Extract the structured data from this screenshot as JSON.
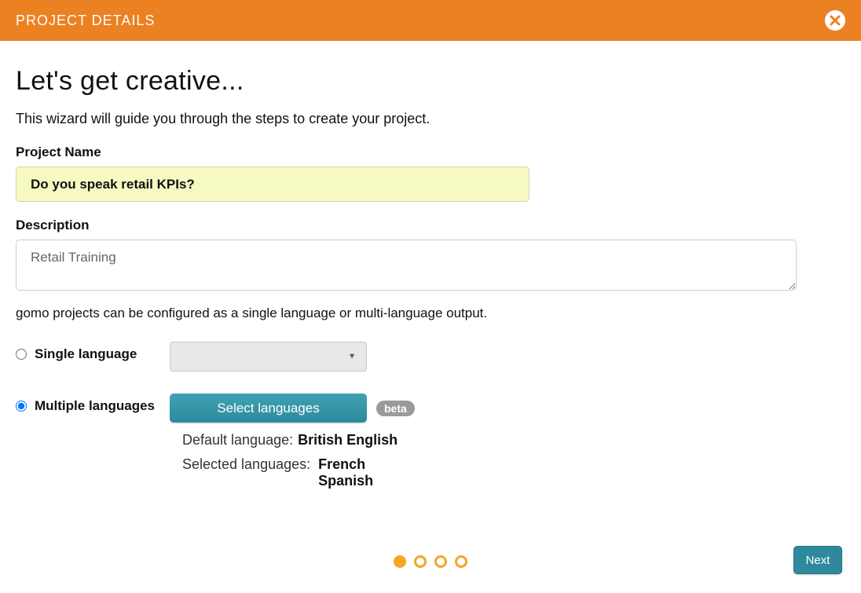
{
  "header": {
    "title": "PROJECT DETAILS"
  },
  "page": {
    "title": "Let's get creative...",
    "subtitle": "This wizard will guide you through the steps to create your project."
  },
  "form": {
    "project_name_label": "Project Name",
    "project_name_value": "Do you speak retail KPIs?",
    "description_label": "Description",
    "description_value": "Retail Training",
    "helper_text": "gomo projects can be configured as a single language or multi-language output.",
    "single_lang_label": "Single language",
    "multi_lang_label": "Multiple languages",
    "select_langs_button": "Select languages",
    "beta_badge": "beta",
    "default_lang_label": "Default language:",
    "default_lang_value": "British English",
    "selected_langs_label": "Selected languages:",
    "selected_langs": [
      "French",
      "Spanish"
    ]
  },
  "footer": {
    "steps_total": 4,
    "steps_current": 1,
    "next_button": "Next"
  }
}
